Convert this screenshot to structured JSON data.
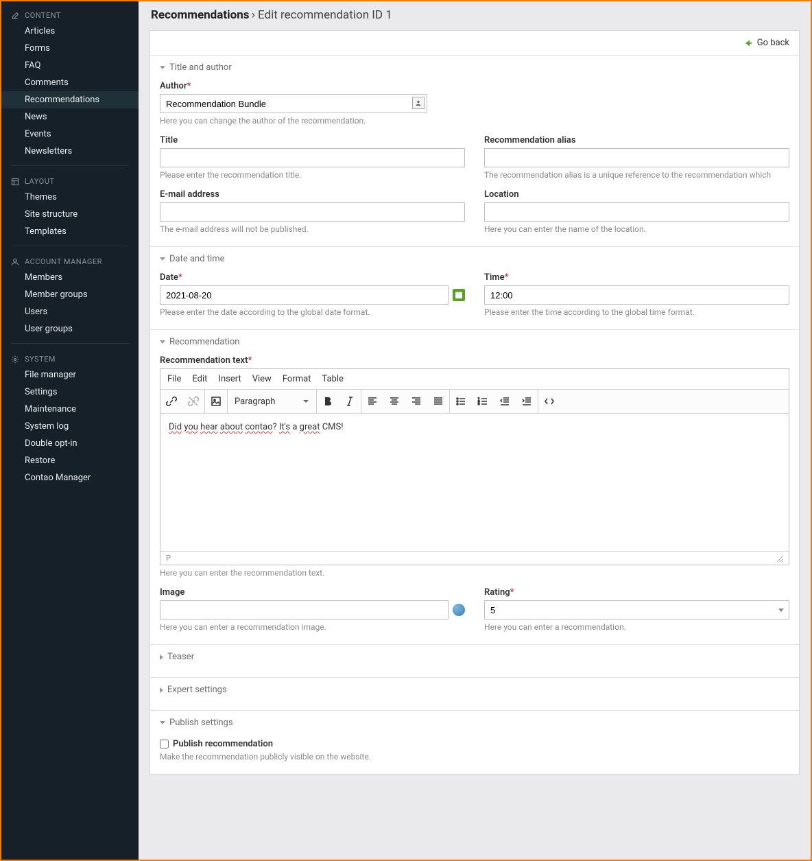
{
  "header": {
    "title": "Recommendations",
    "subtitle": "Edit recommendation ID 1"
  },
  "goback": "Go back",
  "sidebar": {
    "content": {
      "title": "CONTENT",
      "items": [
        "Articles",
        "Forms",
        "FAQ",
        "Comments",
        "Recommendations",
        "News",
        "Events",
        "Newsletters"
      ]
    },
    "layout": {
      "title": "LAYOUT",
      "items": [
        "Themes",
        "Site structure",
        "Templates"
      ]
    },
    "account": {
      "title": "ACCOUNT MANAGER",
      "items": [
        "Members",
        "Member groups",
        "Users",
        "User groups"
      ]
    },
    "system": {
      "title": "SYSTEM",
      "items": [
        "File manager",
        "Settings",
        "Maintenance",
        "System log",
        "Double opt-in",
        "Restore",
        "Contao Manager"
      ]
    }
  },
  "legends": {
    "title_author": "Title and author",
    "date_time": "Date and time",
    "recommendation": "Recommendation",
    "teaser": "Teaser",
    "expert": "Expert settings",
    "publish": "Publish settings"
  },
  "fields": {
    "author": {
      "label": "Author",
      "value": "Recommendation Bundle",
      "help": "Here you can change the author of the recommendation."
    },
    "title": {
      "label": "Title",
      "help": "Please enter the recommendation title."
    },
    "alias": {
      "label": "Recommendation alias",
      "help": "The recommendation alias is a unique reference to the recommendation which"
    },
    "email": {
      "label": "E-mail address",
      "help": "The e-mail address will not be published."
    },
    "location": {
      "label": "Location",
      "help": "Here you can enter the name of the location."
    },
    "date": {
      "label": "Date",
      "value": "2021-08-20",
      "help": "Please enter the date according to the global date format."
    },
    "time": {
      "label": "Time",
      "value": "12:00",
      "help": "Please enter the time according to the global time format."
    },
    "rectext": {
      "label": "Recommendation text",
      "help": "Here you can enter the recommendation text."
    },
    "image": {
      "label": "Image",
      "help": "Here you can enter a recommendation image."
    },
    "rating": {
      "label": "Rating",
      "value": "5",
      "help": "Here you can enter a recommendation."
    },
    "publish": {
      "label": "Publish recommendation",
      "help": "Make the recommendation publicly visible on the website."
    }
  },
  "editor": {
    "menu": [
      "File",
      "Edit",
      "Insert",
      "View",
      "Format",
      "Table"
    ],
    "format": "Paragraph",
    "content_parts": [
      "Did",
      " ",
      "you",
      " ",
      "hear",
      " ",
      "about",
      " ",
      "contao",
      "? ",
      "It's",
      " a ",
      "great",
      " CMS!"
    ],
    "underlined": [
      0,
      2,
      4,
      6,
      8,
      10,
      12
    ],
    "status": "P"
  }
}
